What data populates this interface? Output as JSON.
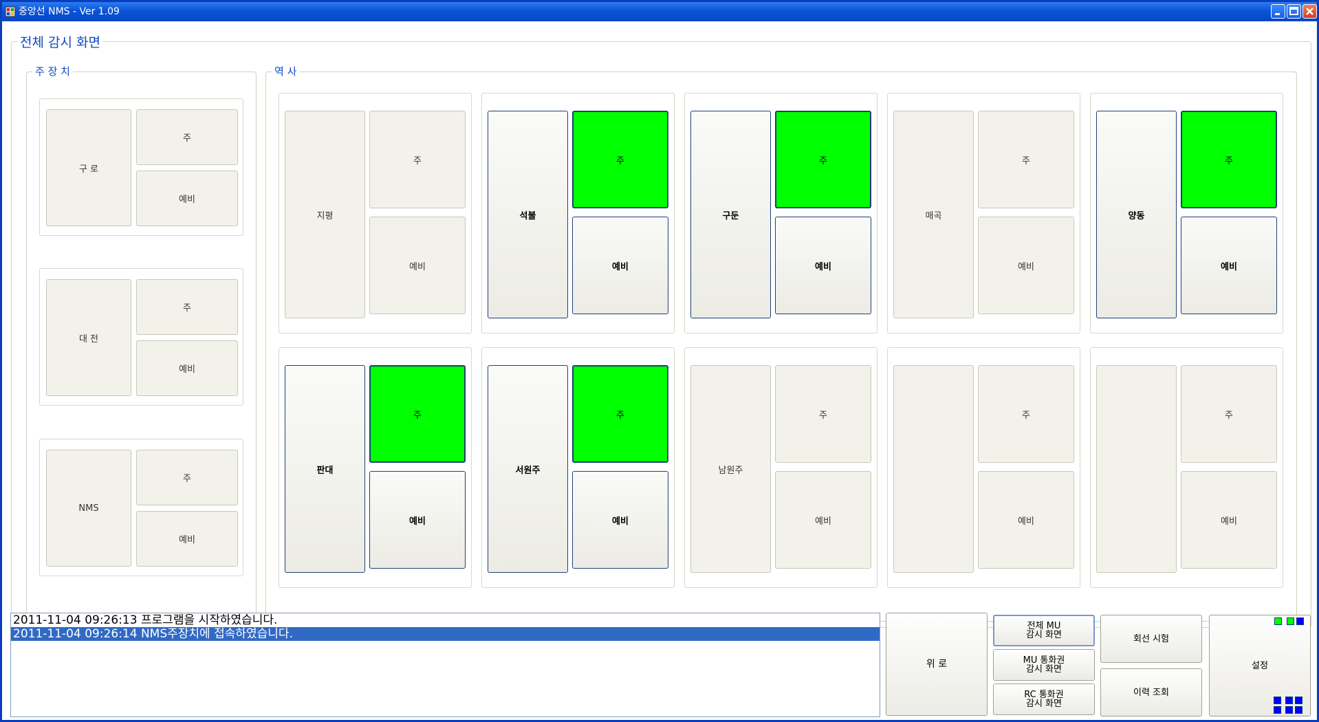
{
  "window": {
    "title": "중앙선 NMS  - Ver 1.09",
    "colors": {
      "titlebar": "#0a54d8",
      "active_green": "#00ff00",
      "selection": "#316ac5"
    }
  },
  "screen": {
    "title": "전체 감시 화면"
  },
  "main_devices": {
    "title": "주 장 치",
    "units": [
      {
        "name": "구 로",
        "primary": "주",
        "backup": "예비"
      },
      {
        "name": "대 전",
        "primary": "주",
        "backup": "예비"
      },
      {
        "name": "NMS",
        "primary": "주",
        "backup": "예비"
      }
    ]
  },
  "stations": {
    "title": "역 사",
    "items": [
      {
        "name": "지평",
        "primary": "주",
        "backup": "예비",
        "active": false,
        "primary_on": false
      },
      {
        "name": "석불",
        "primary": "주",
        "backup": "예비",
        "active": true,
        "primary_on": true
      },
      {
        "name": "구둔",
        "primary": "주",
        "backup": "예비",
        "active": true,
        "primary_on": true
      },
      {
        "name": "매곡",
        "primary": "주",
        "backup": "예비",
        "active": false,
        "primary_on": false
      },
      {
        "name": "양동",
        "primary": "주",
        "backup": "예비",
        "active": true,
        "primary_on": true
      },
      {
        "name": "판대",
        "primary": "주",
        "backup": "예비",
        "active": true,
        "primary_on": true
      },
      {
        "name": "서원주",
        "primary": "주",
        "backup": "예비",
        "active": true,
        "primary_on": true
      },
      {
        "name": "남원주",
        "primary": "주",
        "backup": "예비",
        "active": false,
        "primary_on": false
      },
      {
        "name": "",
        "primary": "주",
        "backup": "예비",
        "active": false,
        "primary_on": false
      },
      {
        "name": "",
        "primary": "주",
        "backup": "예비",
        "active": false,
        "primary_on": false
      }
    ]
  },
  "log": {
    "lines": [
      {
        "text": "2011-11-04 09:26:13 프로그램을 시작하였습니다.",
        "selected": false
      },
      {
        "text": "2011-11-04 09:26:14 NMS주장치에 접속하였습니다.",
        "selected": true
      }
    ]
  },
  "controls": {
    "wiro": "위 로",
    "full_mu_1": "전체 MU",
    "full_mu_2": "감시 화면",
    "mu_area_1": "MU 통화권",
    "mu_area_2": "감시 화면",
    "rc_area_1": "RC 통화권",
    "rc_area_2": "감시 화면",
    "line_test": "회선 시험",
    "history": "이력 조회",
    "settings": "설정"
  }
}
